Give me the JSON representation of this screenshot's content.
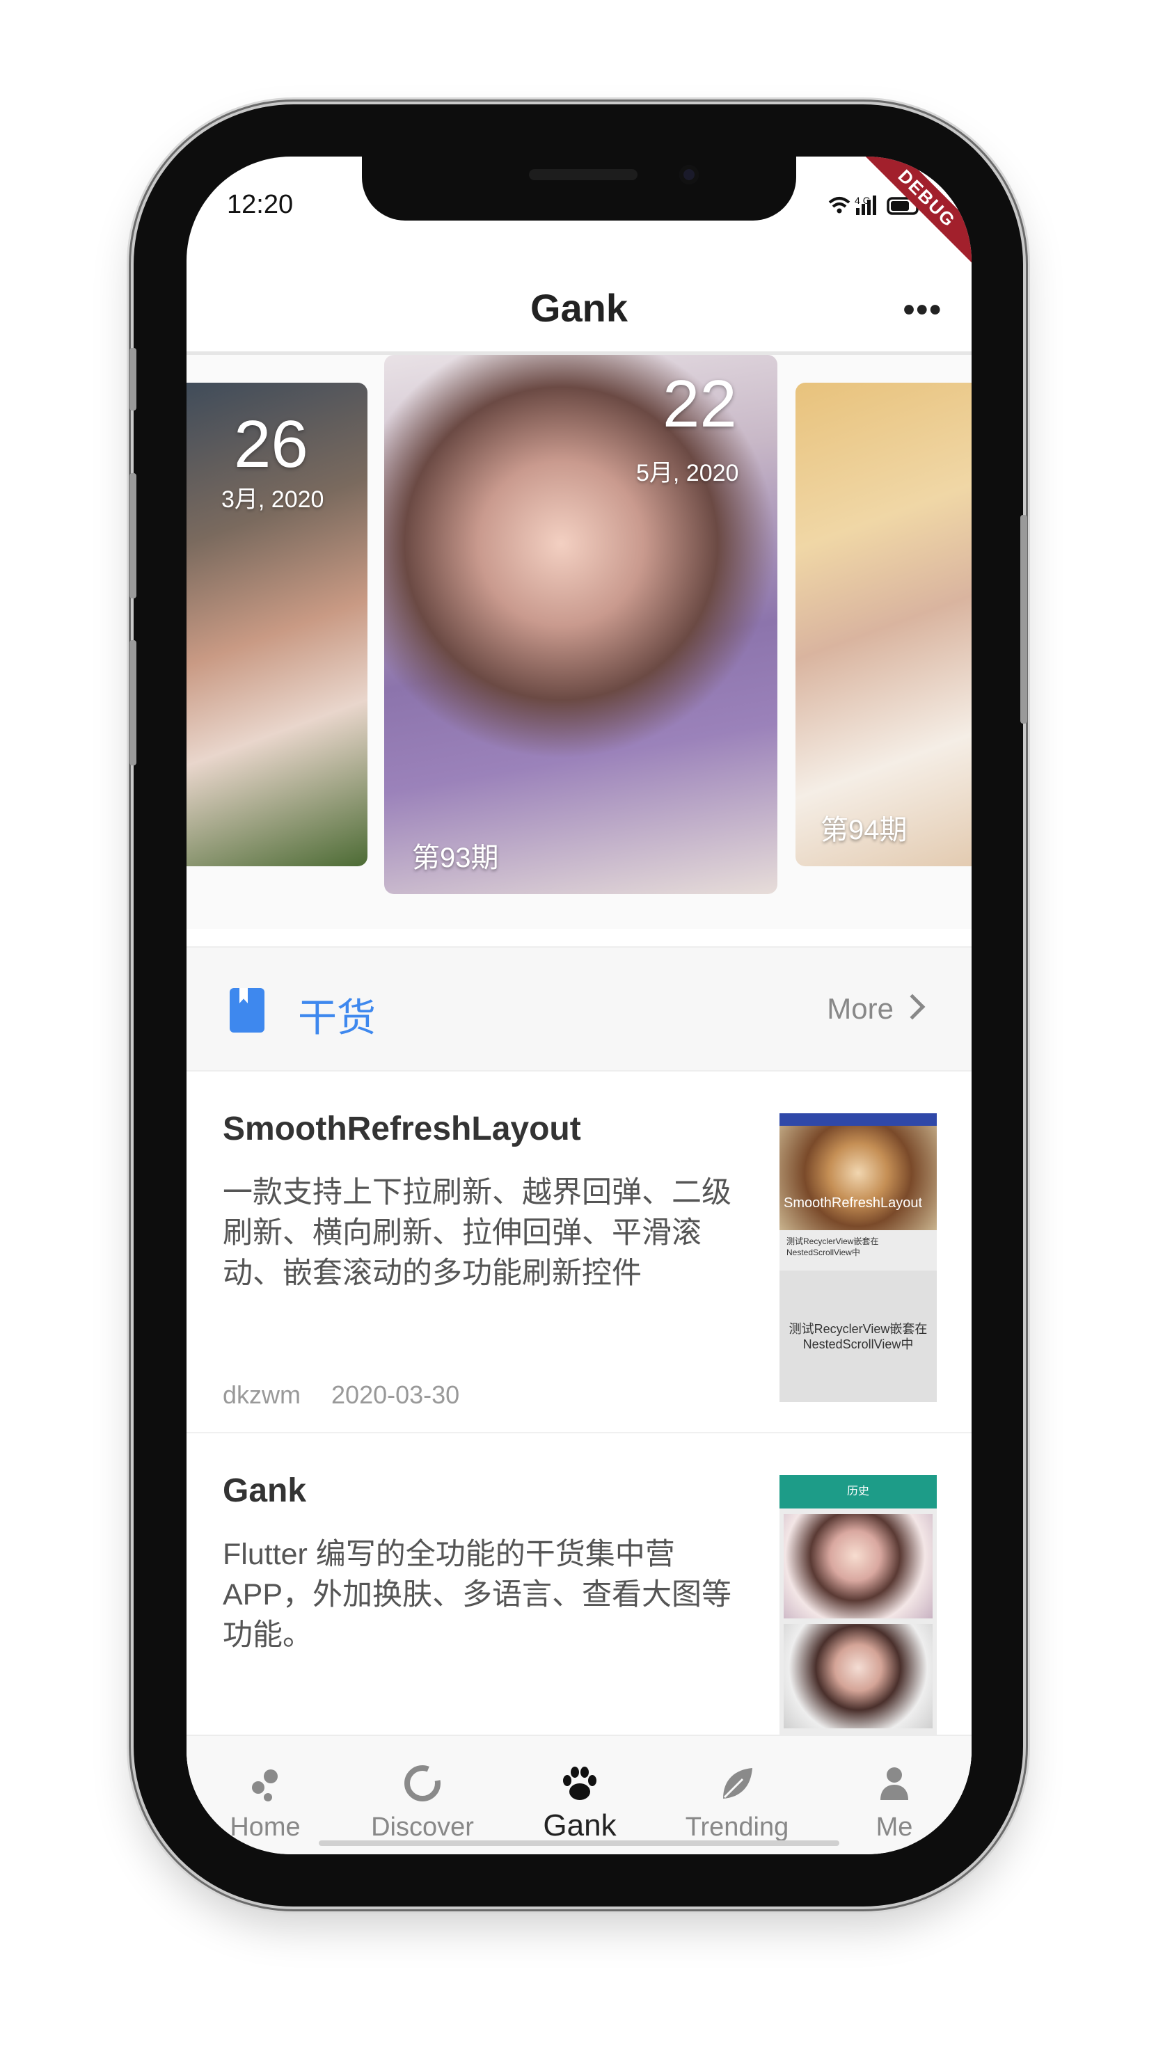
{
  "status_bar": {
    "time": "12:20",
    "icons": "WiFi 4G signal battery",
    "debug": "DEBUG"
  },
  "app_bar": {
    "title": "Gank",
    "menu_icon": "more-horizontal-icon"
  },
  "carousel": {
    "cards": [
      {
        "day": "26",
        "month": "3月, 2020",
        "issue": ""
      },
      {
        "day": "22",
        "month": "5月, 2020",
        "issue": "第93期"
      },
      {
        "day": "",
        "month": "",
        "issue": "第94期"
      }
    ]
  },
  "section": {
    "title": "干货",
    "more": "More",
    "icon": "book-icon"
  },
  "articles": [
    {
      "title": "SmoothRefreshLayout",
      "desc": "一款支持上下拉刷新、越界回弹、二级刷新、横向刷新、拉伸回弹、平滑滚动、嵌套滚动的多功能刷新控件",
      "author": "dkzwm",
      "date": "2020-03-30",
      "thumb_overlay": "SmoothRefreshLayout",
      "thumb_caption": "测试RecyclerView嵌套在NestedScrollView中",
      "thumb_box": "测试RecyclerView嵌套在NestedScrollView中"
    },
    {
      "title": "Gank",
      "desc": "Flutter 编写的全功能的干货集中营APP，外加换肤、多语言、查看大图等功能。",
      "thumb_header": "历史"
    }
  ],
  "bottom_nav": {
    "items": [
      {
        "label": "Home",
        "icon": "bubbles-icon"
      },
      {
        "label": "Discover",
        "icon": "ring-icon"
      },
      {
        "label": "Gank",
        "icon": "paw-icon",
        "active": true
      },
      {
        "label": "Trending",
        "icon": "leaf-icon"
      },
      {
        "label": "Me",
        "icon": "person-icon"
      }
    ]
  },
  "colors": {
    "accent": "#3e88ee",
    "debug_banner": "#a2202c",
    "text_dark": "#222222",
    "text_muted": "#888888"
  }
}
